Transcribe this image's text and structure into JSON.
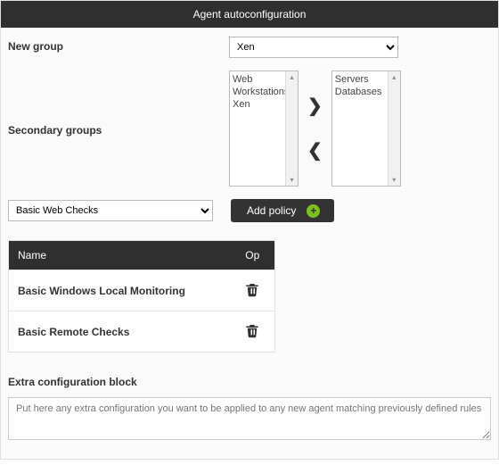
{
  "header": {
    "title": "Agent autoconfiguration"
  },
  "fields": {
    "new_group": {
      "label": "New group",
      "selected": "Xen"
    },
    "secondary": {
      "label": "Secondary groups"
    }
  },
  "dual_list": {
    "left": [
      "Web",
      "Workstations",
      "Xen"
    ],
    "right": [
      "Servers",
      "Databases"
    ]
  },
  "policy": {
    "select_value": "Basic Web Checks",
    "add_btn": "Add policy"
  },
  "table": {
    "headers": {
      "name": "Name",
      "op": "Op"
    },
    "rows": [
      {
        "name": "Basic Windows Local Monitoring"
      },
      {
        "name": "Basic Remote Checks"
      }
    ]
  },
  "extra": {
    "label": "Extra configuration block",
    "placeholder": "Put here any extra configuration you want to be applied to any new agent matching previously defined rules"
  }
}
